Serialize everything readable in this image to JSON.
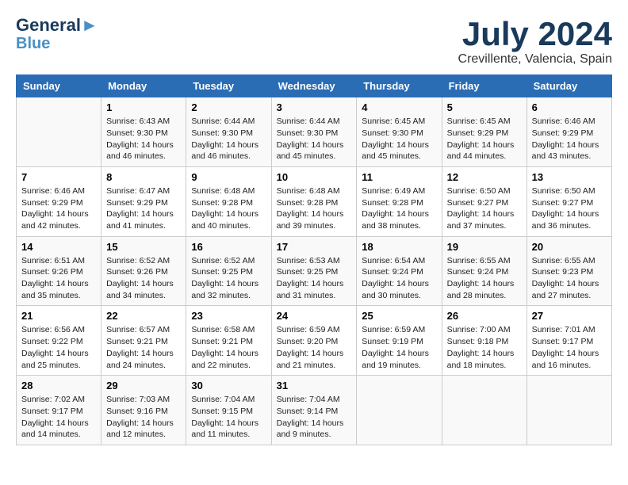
{
  "logo": {
    "line1": "General",
    "line2": "Blue"
  },
  "title": "July 2024",
  "location": "Crevillente, Valencia, Spain",
  "days_of_week": [
    "Sunday",
    "Monday",
    "Tuesday",
    "Wednesday",
    "Thursday",
    "Friday",
    "Saturday"
  ],
  "weeks": [
    [
      {
        "day": "",
        "sunrise": "",
        "sunset": "",
        "daylight": ""
      },
      {
        "day": "1",
        "sunrise": "6:43 AM",
        "sunset": "9:30 PM",
        "daylight": "14 hours and 46 minutes."
      },
      {
        "day": "2",
        "sunrise": "6:44 AM",
        "sunset": "9:30 PM",
        "daylight": "14 hours and 46 minutes."
      },
      {
        "day": "3",
        "sunrise": "6:44 AM",
        "sunset": "9:30 PM",
        "daylight": "14 hours and 45 minutes."
      },
      {
        "day": "4",
        "sunrise": "6:45 AM",
        "sunset": "9:30 PM",
        "daylight": "14 hours and 45 minutes."
      },
      {
        "day": "5",
        "sunrise": "6:45 AM",
        "sunset": "9:29 PM",
        "daylight": "14 hours and 44 minutes."
      },
      {
        "day": "6",
        "sunrise": "6:46 AM",
        "sunset": "9:29 PM",
        "daylight": "14 hours and 43 minutes."
      }
    ],
    [
      {
        "day": "7",
        "sunrise": "6:46 AM",
        "sunset": "9:29 PM",
        "daylight": "14 hours and 42 minutes."
      },
      {
        "day": "8",
        "sunrise": "6:47 AM",
        "sunset": "9:29 PM",
        "daylight": "14 hours and 41 minutes."
      },
      {
        "day": "9",
        "sunrise": "6:48 AM",
        "sunset": "9:28 PM",
        "daylight": "14 hours and 40 minutes."
      },
      {
        "day": "10",
        "sunrise": "6:48 AM",
        "sunset": "9:28 PM",
        "daylight": "14 hours and 39 minutes."
      },
      {
        "day": "11",
        "sunrise": "6:49 AM",
        "sunset": "9:28 PM",
        "daylight": "14 hours and 38 minutes."
      },
      {
        "day": "12",
        "sunrise": "6:50 AM",
        "sunset": "9:27 PM",
        "daylight": "14 hours and 37 minutes."
      },
      {
        "day": "13",
        "sunrise": "6:50 AM",
        "sunset": "9:27 PM",
        "daylight": "14 hours and 36 minutes."
      }
    ],
    [
      {
        "day": "14",
        "sunrise": "6:51 AM",
        "sunset": "9:26 PM",
        "daylight": "14 hours and 35 minutes."
      },
      {
        "day": "15",
        "sunrise": "6:52 AM",
        "sunset": "9:26 PM",
        "daylight": "14 hours and 34 minutes."
      },
      {
        "day": "16",
        "sunrise": "6:52 AM",
        "sunset": "9:25 PM",
        "daylight": "14 hours and 32 minutes."
      },
      {
        "day": "17",
        "sunrise": "6:53 AM",
        "sunset": "9:25 PM",
        "daylight": "14 hours and 31 minutes."
      },
      {
        "day": "18",
        "sunrise": "6:54 AM",
        "sunset": "9:24 PM",
        "daylight": "14 hours and 30 minutes."
      },
      {
        "day": "19",
        "sunrise": "6:55 AM",
        "sunset": "9:24 PM",
        "daylight": "14 hours and 28 minutes."
      },
      {
        "day": "20",
        "sunrise": "6:55 AM",
        "sunset": "9:23 PM",
        "daylight": "14 hours and 27 minutes."
      }
    ],
    [
      {
        "day": "21",
        "sunrise": "6:56 AM",
        "sunset": "9:22 PM",
        "daylight": "14 hours and 25 minutes."
      },
      {
        "day": "22",
        "sunrise": "6:57 AM",
        "sunset": "9:21 PM",
        "daylight": "14 hours and 24 minutes."
      },
      {
        "day": "23",
        "sunrise": "6:58 AM",
        "sunset": "9:21 PM",
        "daylight": "14 hours and 22 minutes."
      },
      {
        "day": "24",
        "sunrise": "6:59 AM",
        "sunset": "9:20 PM",
        "daylight": "14 hours and 21 minutes."
      },
      {
        "day": "25",
        "sunrise": "6:59 AM",
        "sunset": "9:19 PM",
        "daylight": "14 hours and 19 minutes."
      },
      {
        "day": "26",
        "sunrise": "7:00 AM",
        "sunset": "9:18 PM",
        "daylight": "14 hours and 18 minutes."
      },
      {
        "day": "27",
        "sunrise": "7:01 AM",
        "sunset": "9:17 PM",
        "daylight": "14 hours and 16 minutes."
      }
    ],
    [
      {
        "day": "28",
        "sunrise": "7:02 AM",
        "sunset": "9:17 PM",
        "daylight": "14 hours and 14 minutes."
      },
      {
        "day": "29",
        "sunrise": "7:03 AM",
        "sunset": "9:16 PM",
        "daylight": "14 hours and 12 minutes."
      },
      {
        "day": "30",
        "sunrise": "7:04 AM",
        "sunset": "9:15 PM",
        "daylight": "14 hours and 11 minutes."
      },
      {
        "day": "31",
        "sunrise": "7:04 AM",
        "sunset": "9:14 PM",
        "daylight": "14 hours and 9 minutes."
      },
      {
        "day": "",
        "sunrise": "",
        "sunset": "",
        "daylight": ""
      },
      {
        "day": "",
        "sunrise": "",
        "sunset": "",
        "daylight": ""
      },
      {
        "day": "",
        "sunrise": "",
        "sunset": "",
        "daylight": ""
      }
    ]
  ],
  "labels": {
    "sunrise_prefix": "Sunrise: ",
    "sunset_prefix": "Sunset: ",
    "daylight_prefix": "Daylight: "
  }
}
